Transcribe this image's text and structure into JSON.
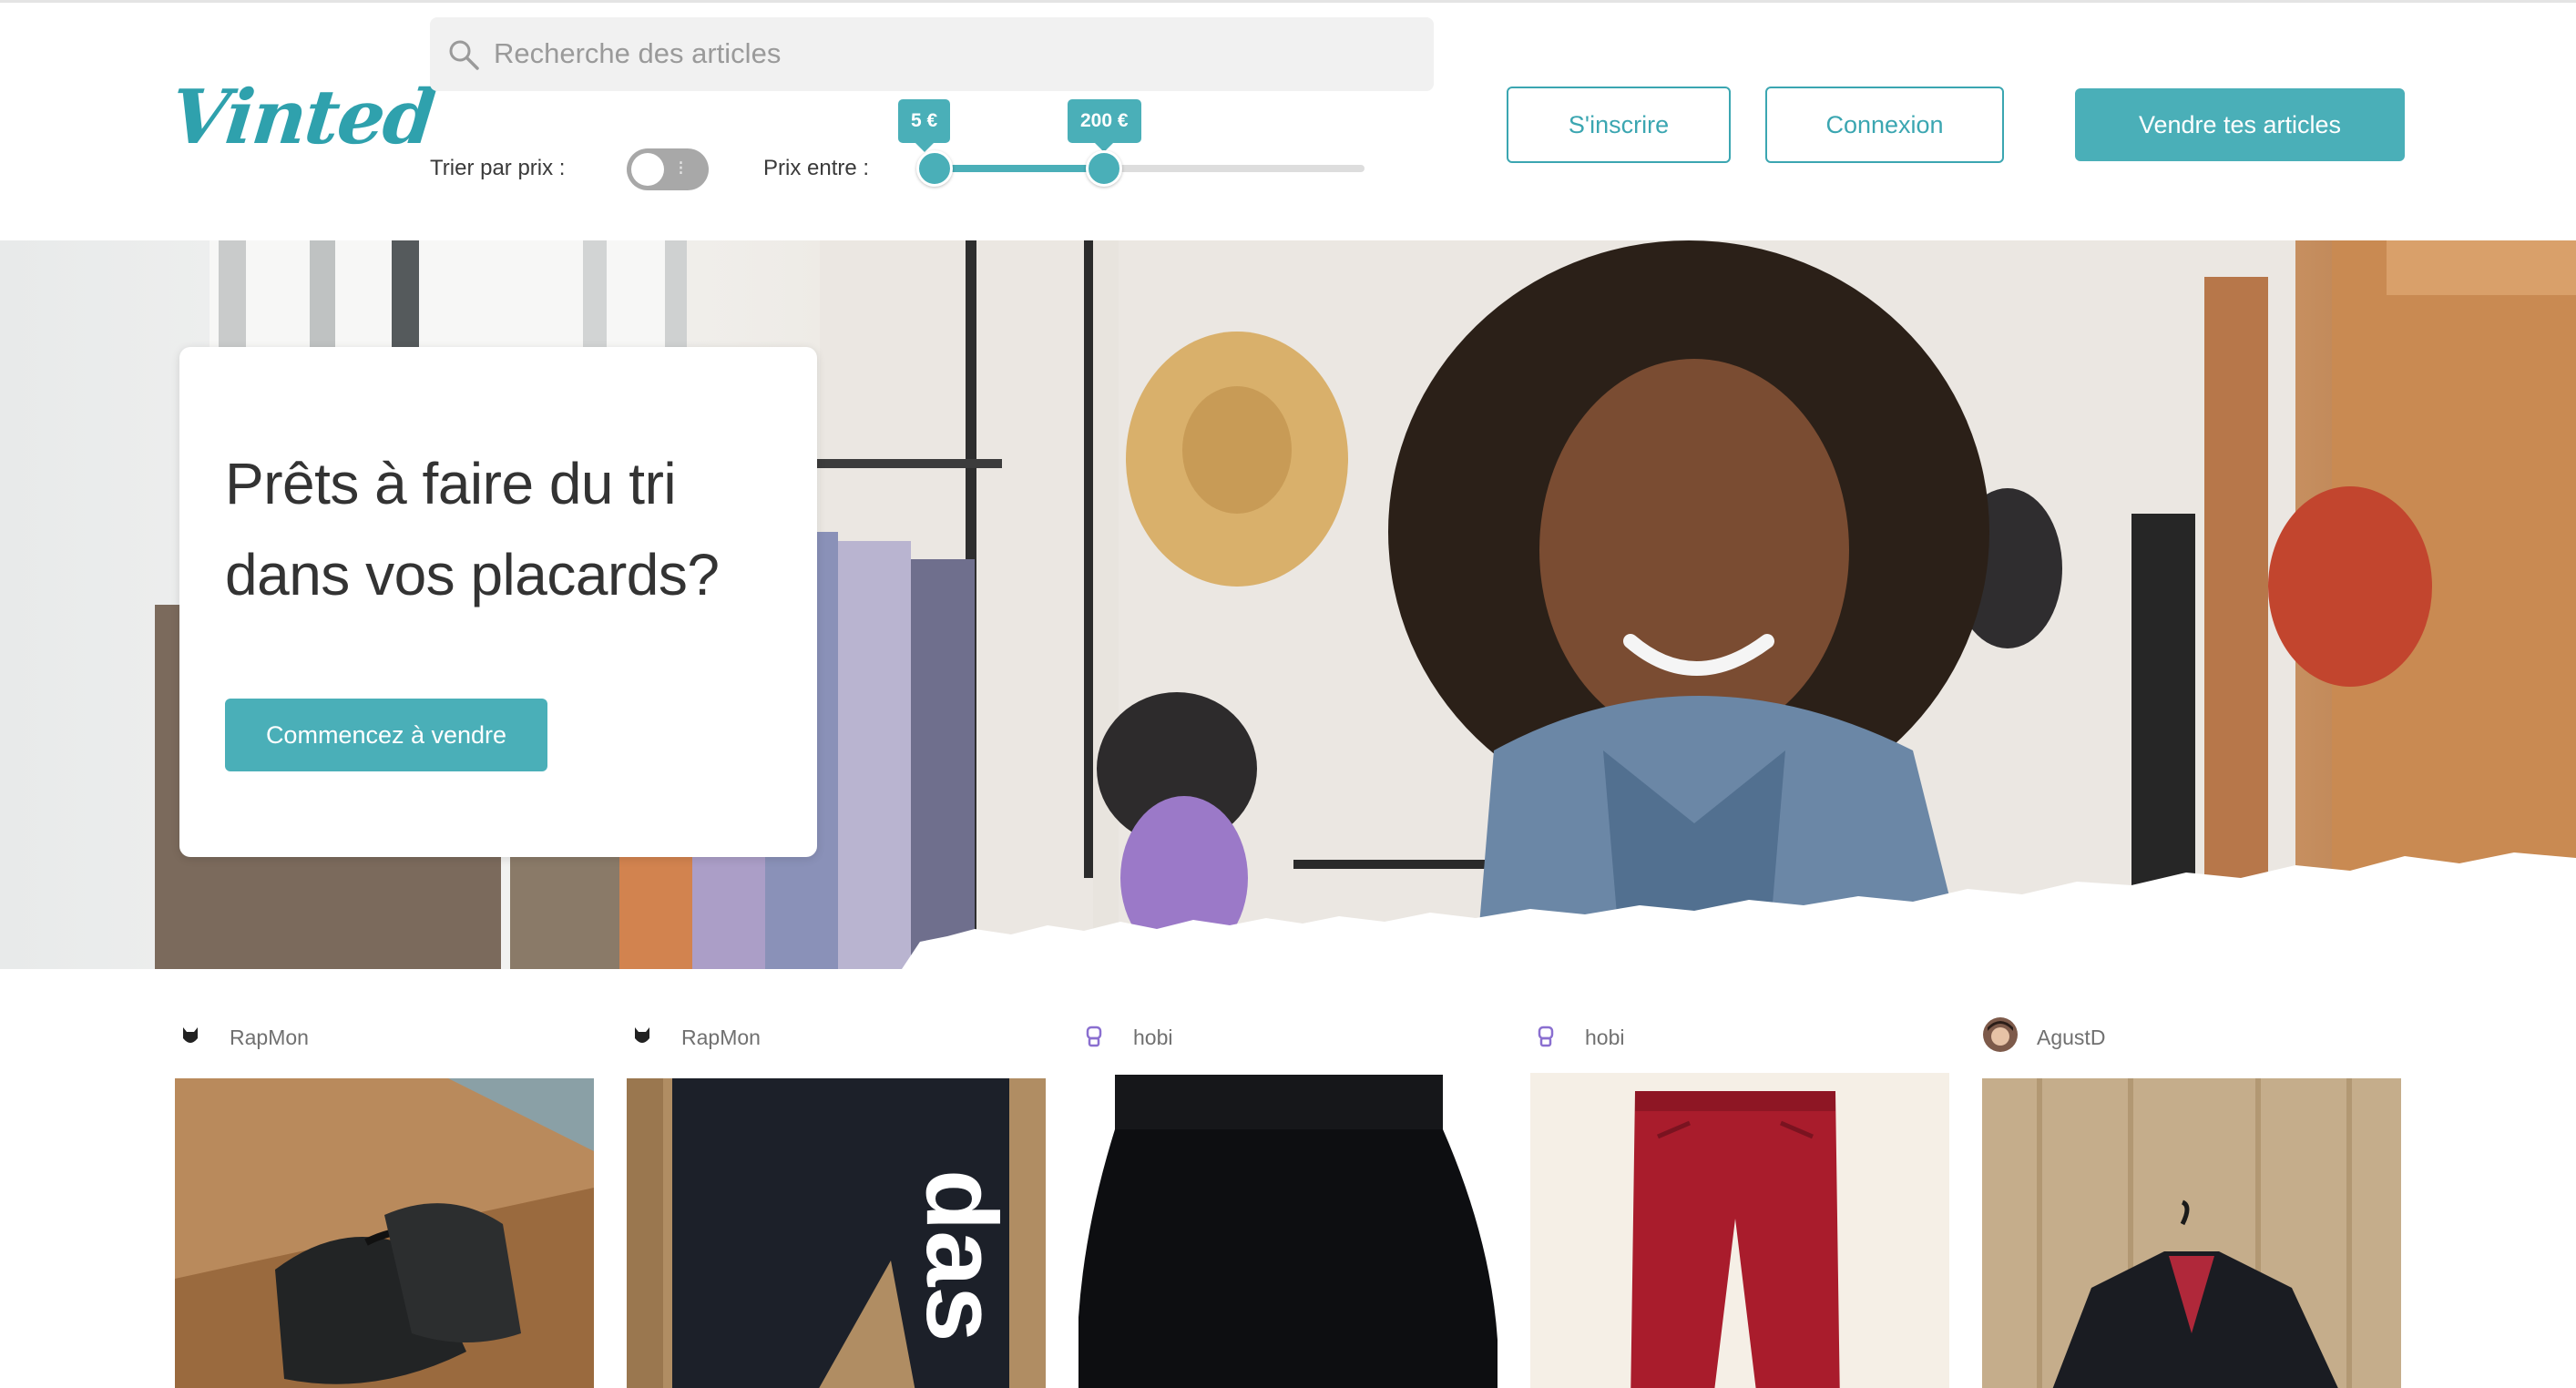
{
  "brand": {
    "logo_text": "Vinted",
    "accent_color": "#4aafb8"
  },
  "search": {
    "placeholder": "Recherche des articles",
    "icon": "search-icon"
  },
  "filters": {
    "sort_label": "Trier par prix :",
    "sort_toggle_on": false,
    "price_label": "Prix entre :",
    "price_min_label": "5 €",
    "price_max_label": "200 €"
  },
  "header_actions": {
    "signup_label": "S'inscrire",
    "login_label": "Connexion",
    "sell_label": "Vendre tes articles"
  },
  "hero": {
    "title_line1": "Prêts à faire du tri",
    "title_line2": "dans vos placards?",
    "cta_label": "Commencez à vendre"
  },
  "items": [
    {
      "username": "RapMon",
      "avatar": "cat-avatar-icon",
      "product": "black leather shoes"
    },
    {
      "username": "RapMon",
      "avatar": "cat-avatar-icon",
      "product": "adidas track pants"
    },
    {
      "username": "hobi",
      "avatar": "robot-avatar-icon",
      "product": "black skirt"
    },
    {
      "username": "hobi",
      "avatar": "robot-avatar-icon",
      "product": "red trousers"
    },
    {
      "username": "AgustD",
      "avatar": "photo-avatar-icon",
      "product": "leather jacket"
    }
  ]
}
